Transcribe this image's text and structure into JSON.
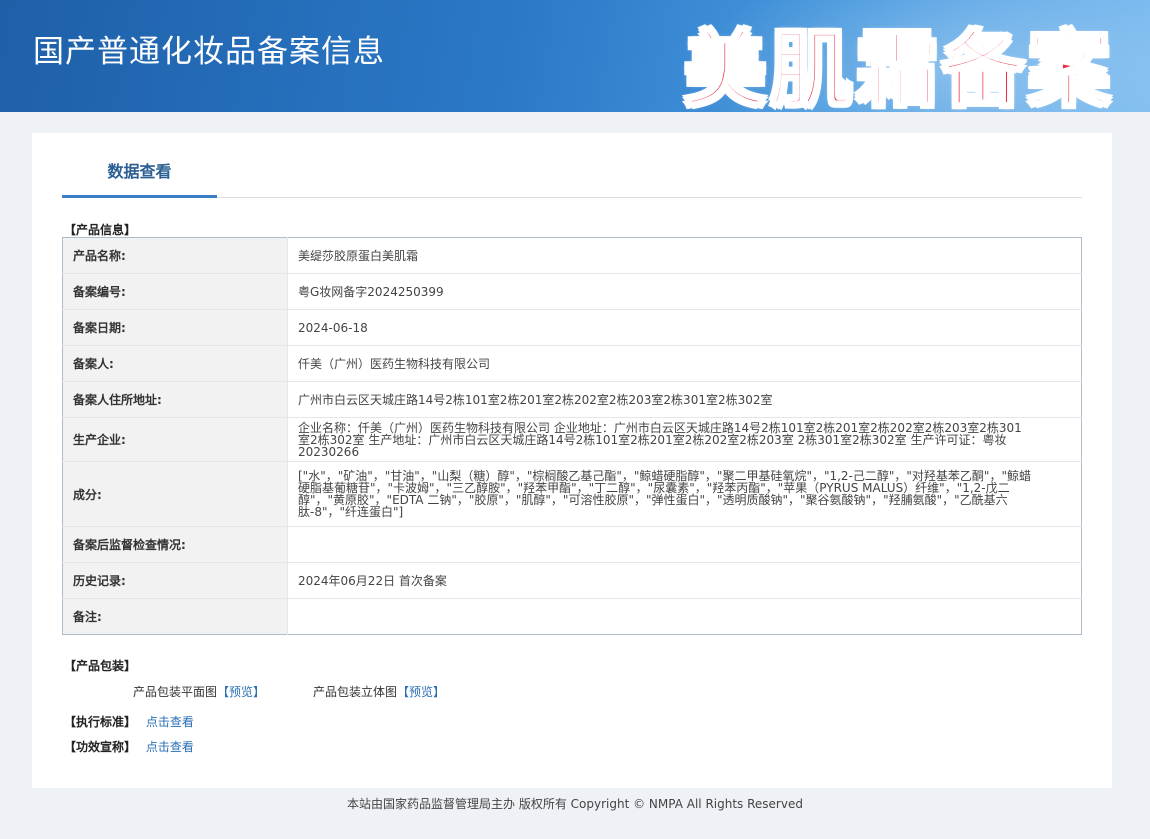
{
  "header": {
    "site_title": "国产普通化妆品备案信息",
    "overlay_title": "美肌霜备案"
  },
  "tab": {
    "label": "数据查看"
  },
  "product_info": {
    "section_label": "【产品信息】",
    "rows": [
      {
        "key": "产品名称:",
        "value": "美缇莎胶原蛋白美肌霜"
      },
      {
        "key": "备案编号:",
        "value": "粤G妆网备字2024250399"
      },
      {
        "key": "备案日期:",
        "value": "2024-06-18"
      },
      {
        "key": "备案人:",
        "value": "仟美（广州）医药生物科技有限公司"
      },
      {
        "key": "备案人住所地址:",
        "value": "广州市白云区天城庄路14号2栋101室2栋201室2栋202室2栋203室2栋301室2栋302室"
      },
      {
        "key": "生产企业:",
        "value": "企业名称：仟美（广州）医药生物科技有限公司 企业地址：广州市白云区天城庄路14号2栋101室2栋201室2栋202室2栋203室2栋301室2栋302室 生产地址：广州市白云区天城庄路14号2栋101室2栋201室2栋202室2栋203室 2栋301室2栋302室 生产许可证：粤妆20230266"
      },
      {
        "key": "成分:",
        "value": "[\"水\"，\"矿油\"，\"甘油\"，\"山梨（糖）醇\"，\"棕榈酸乙基己酯\"，\"鲸蜡硬脂醇\"，\"聚二甲基硅氧烷\"，\"1,2-己二醇\"，\"对羟基苯乙酮\"，\"鲸蜡硬脂基葡糖苷\"，\"卡波姆\"，\"三乙醇胺\"，\"羟苯甲酯\"，\"丁二醇\"，\"尿囊素\"，\"羟苯丙酯\"，\"苹果（PYRUS MALUS）纤维\"，\"1,2-戊二醇\"，\"黄原胶\"，\"EDTA 二钠\"，\"胶原\"，\"肌醇\"，\"可溶性胶原\"，\"弹性蛋白\"，\"透明质酸钠\"，\"聚谷氨酸钠\"，\"羟脯氨酸\"，\"乙酰基六肽-8\"，\"纤连蛋白\"]"
      },
      {
        "key": "备案后监督检查情况:",
        "value": ""
      },
      {
        "key": "历史记录:",
        "value": "2024年06月22日 首次备案"
      },
      {
        "key": "备注:",
        "value": ""
      }
    ]
  },
  "packaging": {
    "section_label": "【产品包装】",
    "flat_label": "产品包装平面图",
    "flat_link": "【预览】",
    "solid_label": "产品包装立体图",
    "solid_link": "【预览】"
  },
  "standard": {
    "label": "【执行标准】",
    "link": "点击查看"
  },
  "efficacy": {
    "label": "【功效宣称】",
    "link": "点击查看"
  },
  "footer": {
    "text": "本站由国家药品监督管理局主办 版权所有 Copyright © NMPA All Rights Reserved"
  }
}
